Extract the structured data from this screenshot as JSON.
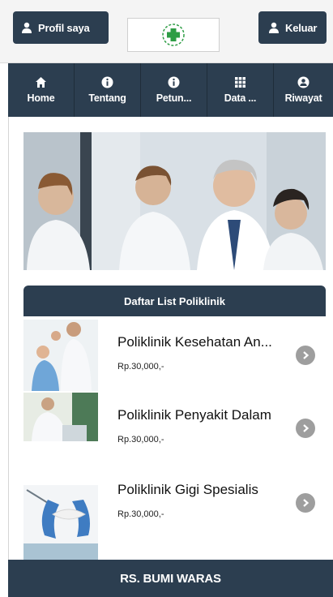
{
  "header": {
    "profile_label": "Profil saya",
    "logout_label": "Keluar"
  },
  "nav": [
    {
      "label": "Home",
      "icon": "home-icon"
    },
    {
      "label": "Tentang",
      "icon": "info-icon"
    },
    {
      "label": "Petun...",
      "icon": "info-icon"
    },
    {
      "label": "Data ...",
      "icon": "grid-icon"
    },
    {
      "label": "Riwayat",
      "icon": "user-icon"
    }
  ],
  "poliklinik": {
    "title": "Daftar List Poliklinik",
    "items": [
      {
        "name": "Poliklinik Kesehatan An...",
        "price": "Rp.30,000,-"
      },
      {
        "name": "Poliklinik Penyakit Dalam",
        "price": "Rp.30,000,-"
      },
      {
        "name": "Poliklinik Gigi Spesialis",
        "price": "Rp.30,000,-"
      }
    ]
  },
  "footer": {
    "title": "RS. BUMI WARAS"
  },
  "colors": {
    "primary": "#2c3e50",
    "chevron": "#9e9e9e",
    "logo_green": "#2e9d45"
  }
}
